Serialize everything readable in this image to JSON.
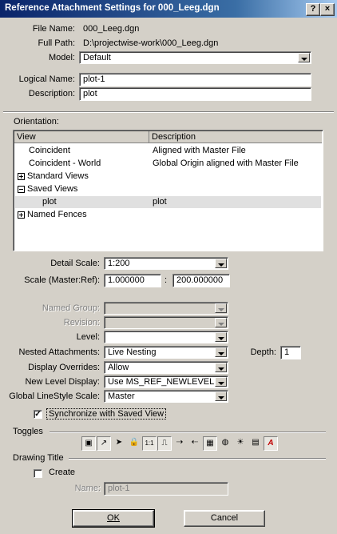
{
  "window": {
    "title": "Reference Attachment Settings for 000_Leeg.dgn",
    "help_button": "?",
    "close_button": "×"
  },
  "file": {
    "file_name_label": "File Name:",
    "file_name": "000_Leeg.dgn",
    "full_path_label": "Full Path:",
    "full_path": "D:\\projectwise-work\\000_Leeg.dgn",
    "model_label": "Model:",
    "model": "Default",
    "logical_name_label": "Logical Name:",
    "logical_name": "plot-1",
    "description_label": "Description:",
    "description": "plot"
  },
  "orientation": {
    "label": "Orientation:",
    "col_view": "View",
    "col_description": "Description",
    "rows": [
      {
        "view": "Coincident",
        "description": "Aligned with Master File",
        "expander": "",
        "selected": false
      },
      {
        "view": "Coincident - World",
        "description": "Global Origin aligned with Master File",
        "expander": "",
        "selected": false
      },
      {
        "view": "Standard Views",
        "description": "",
        "expander": "plus",
        "selected": false
      },
      {
        "view": "Saved Views",
        "description": "",
        "expander": "minus",
        "selected": false
      },
      {
        "view": "plot",
        "description": "plot",
        "expander": "",
        "selected": true
      },
      {
        "view": "Named Fences",
        "description": "",
        "expander": "plus",
        "selected": false
      }
    ]
  },
  "scale": {
    "detail_label": "Detail Scale:",
    "detail": "1:200",
    "master_ref_label": "Scale (Master:Ref):",
    "master": "1.000000",
    "colon": ":",
    "ref": "200.000000"
  },
  "settings": {
    "named_group_label": "Named Group:",
    "named_group": "",
    "revision_label": "Revision:",
    "revision": "",
    "level_label": "Level:",
    "level": "",
    "nested_label": "Nested Attachments:",
    "nested": "Live Nesting",
    "depth_label": "Depth:",
    "depth": "1",
    "display_overrides_label": "Display Overrides:",
    "display_overrides": "Allow",
    "new_level_label": "New Level Display:",
    "new_level": "Use MS_REF_NEWLEVELDI",
    "linestyle_label": "Global LineStyle Scale:",
    "linestyle": "Master",
    "sync_label": "Synchronize with Saved View",
    "sync_checked": true
  },
  "toggles": {
    "label": "Toggles",
    "icons": [
      {
        "name": "display-toggle-icon",
        "glyph": "▣",
        "on": true
      },
      {
        "name": "snap-toggle-icon",
        "glyph": "↗",
        "on": true
      },
      {
        "name": "locate-toggle-icon",
        "glyph": "➤",
        "on": false
      },
      {
        "name": "lock-toggle-icon",
        "glyph": "🔒",
        "on": false
      },
      {
        "name": "true-scale-toggle-icon",
        "glyph": "1:1",
        "on": true
      },
      {
        "name": "scale-linestyles-toggle-icon",
        "glyph": "⎍",
        "on": true
      },
      {
        "name": "treat-as-element-toggle-icon",
        "glyph": "⇢",
        "on": false
      },
      {
        "name": "ignore-attachment-toggle-icon",
        "glyph": "⇠",
        "on": false
      },
      {
        "name": "level-grid-toggle-icon",
        "glyph": "▦",
        "on": true
      },
      {
        "name": "global-toggle-icon",
        "glyph": "◍",
        "on": false
      },
      {
        "name": "light-toggle-icon",
        "glyph": "☀",
        "on": false
      },
      {
        "name": "copy-toggle-icon",
        "glyph": "▤",
        "on": false
      },
      {
        "name": "annotation-toggle-icon",
        "glyph": "A",
        "on": true
      }
    ]
  },
  "drawing_title": {
    "label": "Drawing Title",
    "create_label": "Create",
    "create_checked": false,
    "name_label": "Name:",
    "name": "plot-1"
  },
  "buttons": {
    "ok": "OK",
    "cancel": "Cancel"
  }
}
